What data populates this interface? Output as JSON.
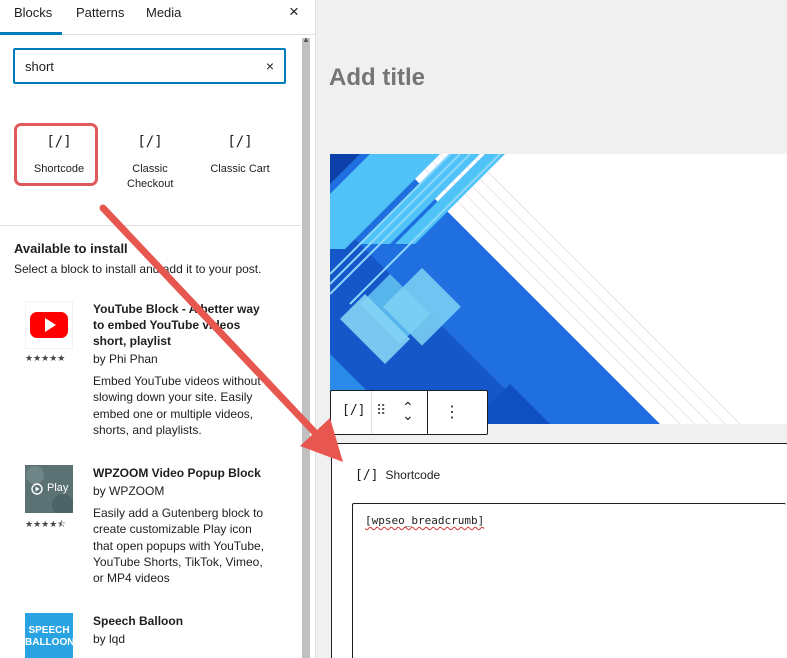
{
  "inserter": {
    "tabs": [
      "Blocks",
      "Patterns",
      "Media"
    ],
    "close_icon": "×",
    "search": {
      "value": "short",
      "clear_icon": "×"
    },
    "results": [
      {
        "icon": "[/]",
        "label": "Shortcode"
      },
      {
        "icon": "[/]",
        "label": "Classic Checkout"
      },
      {
        "icon": "[/]",
        "label": "Classic Cart"
      }
    ],
    "install_section": {
      "title": "Available to install",
      "description": "Select a block to install and add it to your post."
    },
    "plugins": [
      {
        "title": "YouTube Block - A better way to embed YouTube videos short, playlist",
        "author": "by Phi Phan",
        "description": "Embed YouTube videos without slowing down your site. Easily embed one or multiple videos, shorts, and playlists.",
        "rating": 5,
        "stars": "★★★★★",
        "icon": "youtube-icon"
      },
      {
        "title": "WPZOOM Video Popup Block",
        "author": "by WPZOOM",
        "description": "Easily add a Gutenberg block to create customizable Play icon that open popups with YouTube, YouTube Shorts, TikTok, Vimeo, or MP4 videos",
        "rating": 4.5,
        "stars": "★★★★⯪",
        "thumb_label": "Play",
        "icon": "video-popup-icon"
      },
      {
        "title": "Speech Balloon",
        "author": "by lqd",
        "thumb_label": "SPEECH BALLOON",
        "icon": "speech-balloon-icon"
      }
    ]
  },
  "editor": {
    "title_placeholder": "Add title",
    "toolbar": {
      "block_icon": "[/]",
      "drag_icon": "⠿",
      "up_icon": "⌃",
      "down_icon": "⌄",
      "more_icon": "⋮"
    },
    "shortcode_block": {
      "icon": "[/]",
      "label": "Shortcode",
      "value": "[wpseo_breadcrumb]"
    }
  },
  "colors": {
    "accent": "#007cba",
    "highlight": "#e05a5a",
    "arrow": "#e8574f",
    "youtube": "#ff0000",
    "speech_balloon": "#2aa3e2"
  }
}
